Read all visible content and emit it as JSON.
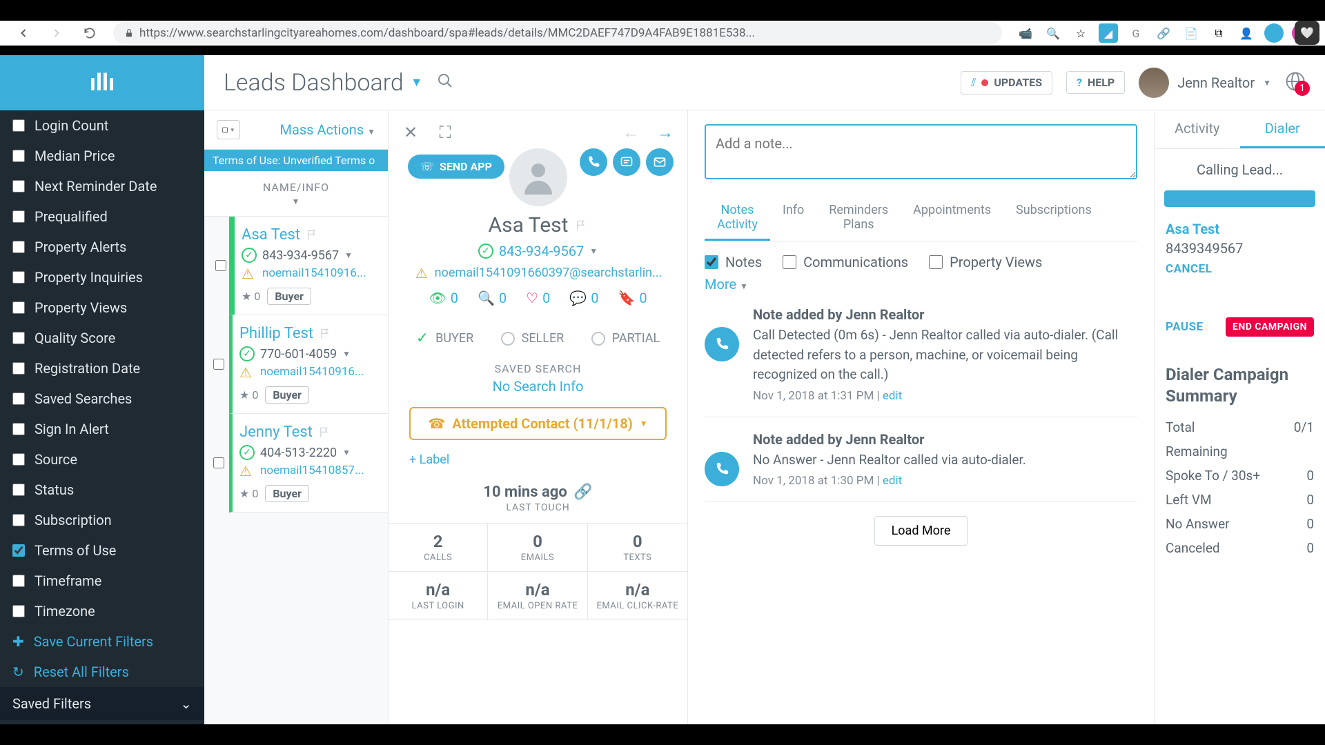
{
  "browser": {
    "url": "https://www.searchstarlingcityareahomes.com/dashboard/spa#leads/details/MMC2DAEF747D9A4FAB9E1881E538..."
  },
  "sidebar": {
    "filters": [
      {
        "label": "Login Count",
        "checked": false
      },
      {
        "label": "Median Price",
        "checked": false
      },
      {
        "label": "Next Reminder Date",
        "checked": false
      },
      {
        "label": "Prequalified",
        "checked": false
      },
      {
        "label": "Property Alerts",
        "checked": false
      },
      {
        "label": "Property Inquiries",
        "checked": false
      },
      {
        "label": "Property Views",
        "checked": false
      },
      {
        "label": "Quality Score",
        "checked": false
      },
      {
        "label": "Registration Date",
        "checked": false
      },
      {
        "label": "Saved Searches",
        "checked": false
      },
      {
        "label": "Sign In Alert",
        "checked": false
      },
      {
        "label": "Source",
        "checked": false
      },
      {
        "label": "Status",
        "checked": false
      },
      {
        "label": "Subscription",
        "checked": false
      },
      {
        "label": "Terms of Use",
        "checked": true
      },
      {
        "label": "Timeframe",
        "checked": false
      },
      {
        "label": "Timezone",
        "checked": false
      }
    ],
    "save_filters": "Save Current Filters",
    "reset_filters": "Reset All Filters",
    "saved_filters_header": "Saved Filters"
  },
  "topbar": {
    "title": "Leads Dashboard",
    "updates": "UPDATES",
    "help": "HELP",
    "user": "Jenn Realtor",
    "notif_count": "1"
  },
  "leads": {
    "mass_actions": "Mass Actions",
    "terms_banner": "Terms of Use:  Unverified Terms o",
    "column_header": "NAME/INFO",
    "items": [
      {
        "name": "Asa Test",
        "phone": "843-934-9567",
        "email": "noemail15410916...",
        "rating": "0",
        "tag": "Buyer"
      },
      {
        "name": "Phillip Test",
        "phone": "770-601-4059",
        "email": "noemail15410916...",
        "rating": "0",
        "tag": "Buyer"
      },
      {
        "name": "Jenny Test",
        "phone": "404-513-2220",
        "email": "noemail15410857...",
        "rating": "0",
        "tag": "Buyer"
      }
    ]
  },
  "detail": {
    "send_app": "SEND APP",
    "name": "Asa Test",
    "phone": "843-934-9567",
    "email": "noemail1541091660397@searchstarlin...",
    "stats": {
      "views": "0",
      "searches": "0",
      "favs": "0",
      "questions": "0",
      "attachments": "0"
    },
    "types": {
      "buyer": "BUYER",
      "seller": "SELLER",
      "partial": "PARTIAL"
    },
    "saved_search_label": "SAVED SEARCH",
    "saved_search_val": "No Search Info",
    "contact_status": "Attempted Contact (11/1/18)",
    "add_label": "+ Label",
    "last_touch": "10 mins ago",
    "last_touch_label": "LAST TOUCH",
    "metrics": [
      {
        "val": "2",
        "label": "CALLS"
      },
      {
        "val": "0",
        "label": "EMAILS"
      },
      {
        "val": "0",
        "label": "TEXTS"
      },
      {
        "val": "n/a",
        "label": "LAST LOGIN"
      },
      {
        "val": "n/a",
        "label": "EMAIL OPEN RATE"
      },
      {
        "val": "n/a",
        "label": "EMAIL CLICK-RATE"
      }
    ]
  },
  "notes": {
    "placeholder": "Add a note...",
    "tabs": [
      "Notes + Activity",
      "Info",
      "Reminders + Plans",
      "Appointments",
      "Subscriptions"
    ],
    "filter_notes": "Notes",
    "filter_comm": "Communications",
    "filter_views": "Property Views",
    "more": "More",
    "entries": [
      {
        "title": "Note added by Jenn Realtor",
        "text": "Call Detected (0m 6s) - Jenn Realtor called via auto-dialer. (Call detected refers to a person, machine, or voicemail being recognized on the call.)",
        "date": "Nov 1, 2018 at 1:31 PM",
        "edit": "edit"
      },
      {
        "title": "Note added by Jenn Realtor",
        "text": "No Answer - Jenn Realtor called via auto-dialer.",
        "date": "Nov 1, 2018 at 1:30 PM",
        "edit": "edit"
      }
    ],
    "load_more": "Load More"
  },
  "dialer": {
    "tab_activity": "Activity",
    "tab_dialer": "Dialer",
    "calling": "Calling Lead...",
    "target_name": "Asa Test",
    "target_phone": "8439349567",
    "cancel": "CANCEL",
    "pause": "PAUSE",
    "end": "END CAMPAIGN",
    "summary_title": "Dialer Campaign Summary",
    "rows": [
      {
        "label": "Total",
        "val": "0/1"
      },
      {
        "label": "Remaining",
        "val": ""
      },
      {
        "label": "Spoke To / 30s+",
        "val": "0"
      },
      {
        "label": "Left VM",
        "val": "0"
      },
      {
        "label": "No Answer",
        "val": "0"
      },
      {
        "label": "Canceled",
        "val": "0"
      }
    ]
  }
}
